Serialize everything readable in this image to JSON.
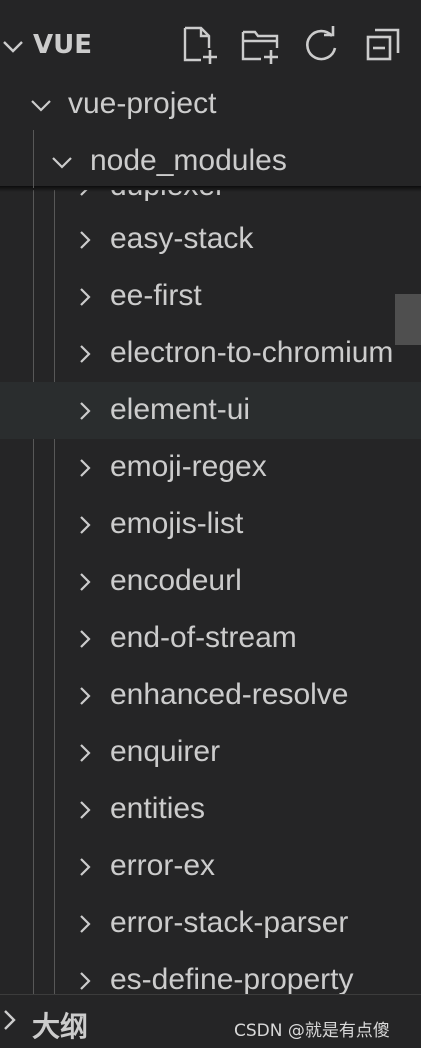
{
  "explorer": {
    "section_title": "VUE",
    "actions": [
      "new-file-icon",
      "new-folder-icon",
      "refresh-icon",
      "collapse-all-icon"
    ]
  },
  "tree": {
    "project": "vue-project",
    "node_modules": "node_modules",
    "partial_top": "duplexer",
    "items": [
      "easy-stack",
      "ee-first",
      "electron-to-chromium",
      "element-ui",
      "emoji-regex",
      "emojis-list",
      "encodeurl",
      "end-of-stream",
      "enhanced-resolve",
      "enquirer",
      "entities",
      "error-ex",
      "error-stack-parser",
      "es-define-property"
    ],
    "hovered_item": "element-ui"
  },
  "outline": {
    "title": "大纲"
  },
  "watermark": "CSDN @就是有点傻",
  "colors": {
    "background": "#252526",
    "text": "#cccccc",
    "hover": "#2a2d2e",
    "guide": "#585858"
  }
}
